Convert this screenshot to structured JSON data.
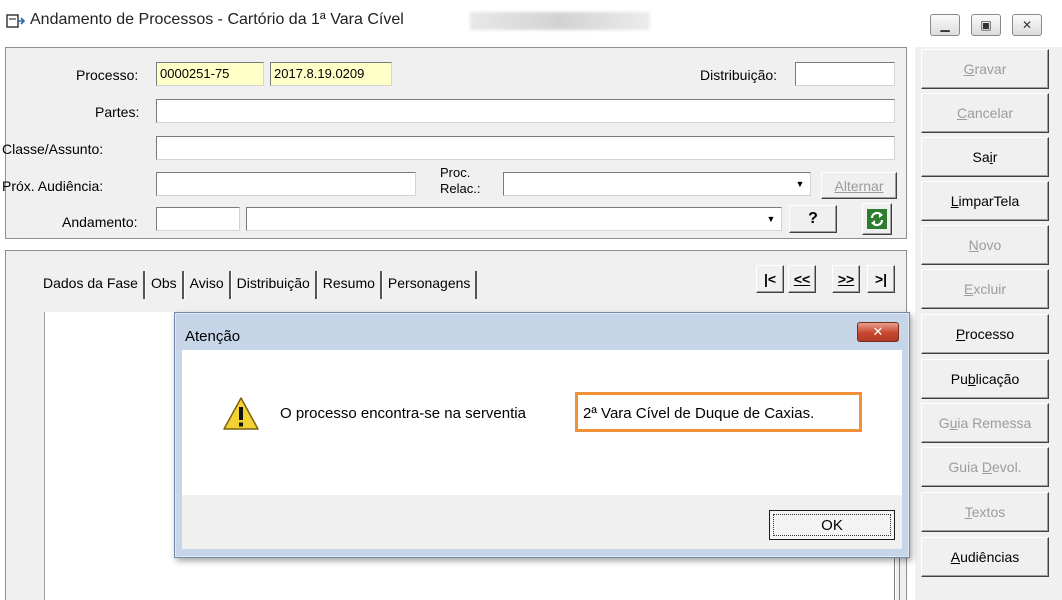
{
  "window": {
    "title": "Andamento de Processos - Cartório da 1ª Vara Cível"
  },
  "form": {
    "processo_label": "Processo:",
    "processo_value_1": "0000251-75",
    "processo_value_2": "2017.8.19.0209",
    "distribuicao_label": "Distribuição:",
    "distribuicao_value": "",
    "partes_label": "Partes:",
    "partes_value": "",
    "classe_label": "Classe/Assunto:",
    "classe_value": "",
    "audiencia_label": "Próx. Audiência:",
    "audiencia_value": "",
    "proc_relac_label_1": "Proc.",
    "proc_relac_label_2": "Relac.:",
    "proc_relac_value": "",
    "alternar_label": "Alternar",
    "andamento_label": "Andamento:",
    "andamento_code": "",
    "andamento_value": "",
    "help_label": "?"
  },
  "sidebar": {
    "buttons": [
      {
        "pre": "",
        "u": "G",
        "post": "ravar",
        "enabled": false
      },
      {
        "pre": "",
        "u": "C",
        "post": "ancelar",
        "enabled": false
      },
      {
        "pre": "Sa",
        "u": "i",
        "post": "r",
        "enabled": true
      },
      {
        "pre": "",
        "u": "L",
        "post": "imparTela",
        "enabled": true
      },
      {
        "pre": "",
        "u": "N",
        "post": "ovo",
        "enabled": false
      },
      {
        "pre": "",
        "u": "E",
        "post": "xcluir",
        "enabled": false
      },
      {
        "pre": "",
        "u": "P",
        "post": "rocesso",
        "enabled": true
      },
      {
        "pre": "Pu",
        "u": "b",
        "post": "licação",
        "enabled": true
      },
      {
        "pre": "G",
        "u": "u",
        "post": "ia Remessa",
        "enabled": false
      },
      {
        "pre": "Guia ",
        "u": "D",
        "post": "evol.",
        "enabled": false
      },
      {
        "pre": "",
        "u": "T",
        "post": "extos",
        "enabled": false
      },
      {
        "pre": "",
        "u": "A",
        "post": "udiências",
        "enabled": true
      }
    ]
  },
  "tabs": [
    "Dados da Fase",
    "Obs",
    "Aviso",
    "Distribuição",
    "Resumo",
    "Personagens"
  ],
  "nav": {
    "first": "|<",
    "prev": "<<",
    "next": ">>",
    "last": ">|"
  },
  "dialog": {
    "title": "Atenção",
    "message": "O processo encontra-se na serventia",
    "highlight": "2ª Vara Cível de Duque de Caxias.",
    "ok": "OK"
  },
  "colors": {
    "highlight_border": "#f0913a",
    "yellow_field": "#ffffc8",
    "disabled_text": "#9c9c9c"
  }
}
